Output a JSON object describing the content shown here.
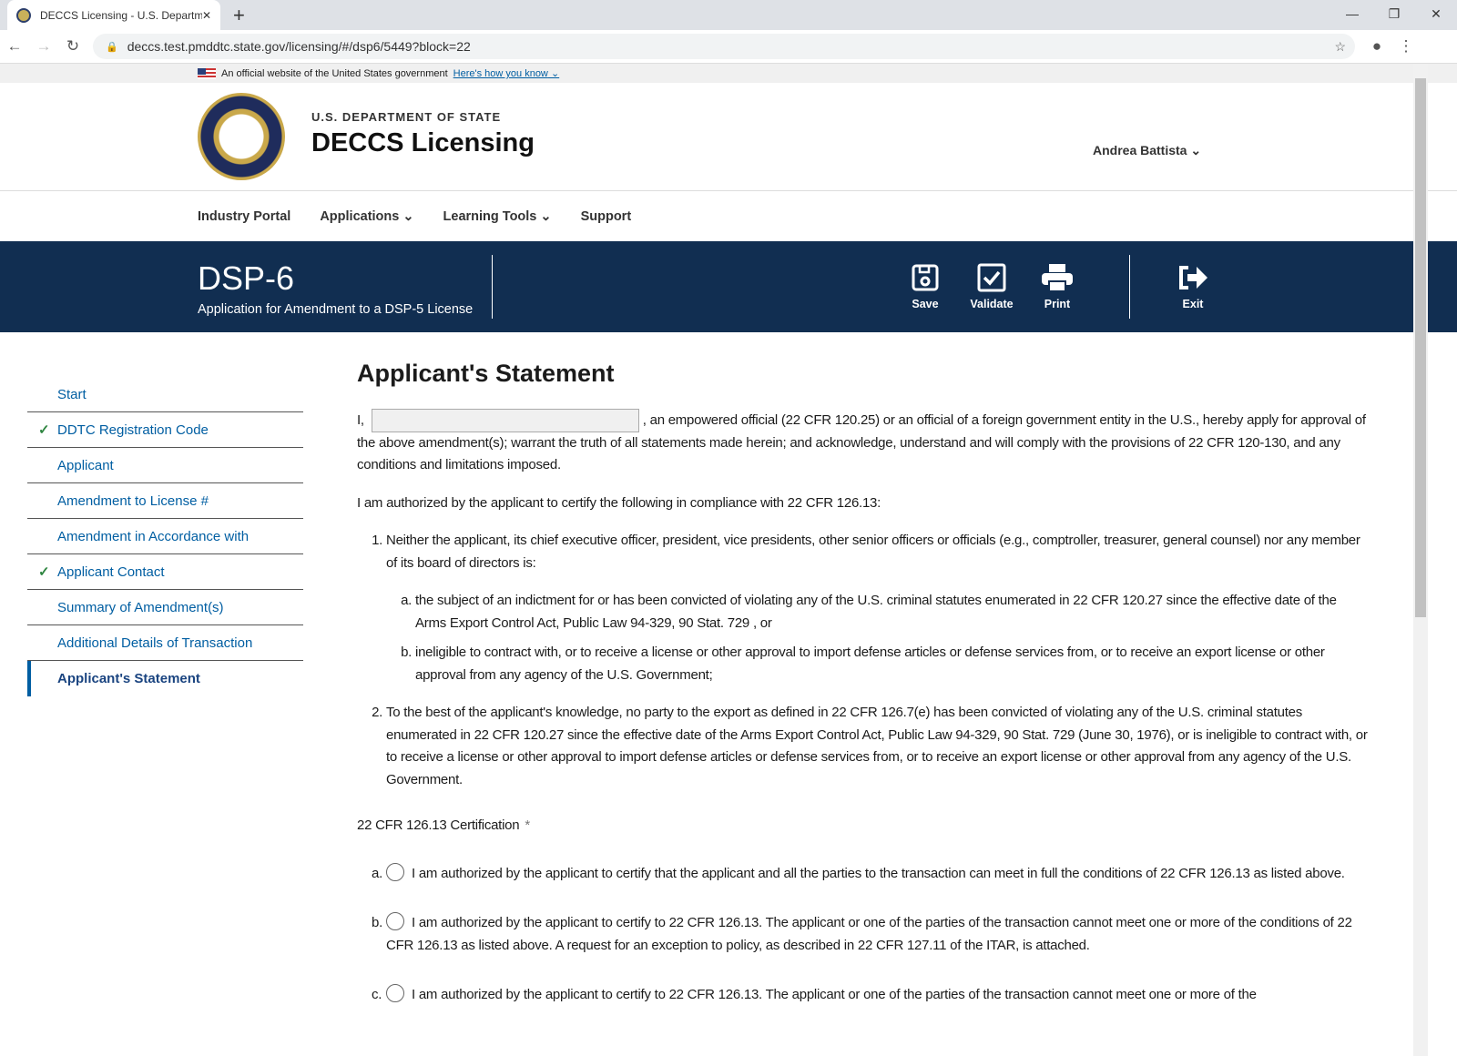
{
  "browser": {
    "tab_title": "DECCS Licensing - U.S. Departme",
    "url": "deccs.test.pmddtc.state.gov/licensing/#/dsp6/5449?block=22"
  },
  "banner": {
    "text": "An official website of the United States government",
    "link": "Here's how you know"
  },
  "header": {
    "dept": "U.S. DEPARTMENT OF STATE",
    "brand": "DECCS Licensing",
    "user": "Andrea Battista"
  },
  "nav": [
    "Industry Portal",
    "Applications",
    "Learning Tools",
    "Support"
  ],
  "band": {
    "title": "DSP-6",
    "subtitle": "Application for Amendment to a DSP-5 License",
    "tools": {
      "save": "Save",
      "validate": "Validate",
      "print": "Print",
      "exit": "Exit"
    }
  },
  "sidebar": [
    {
      "label": "Start",
      "done": false
    },
    {
      "label": "DDTC Registration Code",
      "done": true
    },
    {
      "label": "Applicant",
      "done": false
    },
    {
      "label": "Amendment to License #",
      "done": false
    },
    {
      "label": "Amendment in Accordance with",
      "done": false
    },
    {
      "label": "Applicant Contact",
      "done": true
    },
    {
      "label": "Summary of Amendment(s)",
      "done": false
    },
    {
      "label": "Additional Details of Transaction",
      "done": false
    },
    {
      "label": "Applicant's Statement",
      "done": false,
      "active": true
    }
  ],
  "main": {
    "title": "Applicant's Statement",
    "intro_pre": "I,",
    "name_value": "",
    "intro_post": ", an empowered official (22 CFR 120.25) or an official of a foreign government entity in the U.S., hereby apply for approval of the above amendment(s); warrant the truth of all statements made herein; and acknowledge, understand and will comply with the provisions of 22 CFR 120-130, and any conditions and limitations imposed.",
    "authorized": "I am authorized by the applicant to certify the following in compliance with 22 CFR 126.13:",
    "item1": "Neither the applicant, its chief executive officer, president, vice presidents, other senior officers or officials (e.g., comptroller, treasurer, general counsel) nor any member of its board of directors is:",
    "item1a": "the subject of an indictment for or has been convicted of violating any of the U.S. criminal statutes enumerated in 22 CFR 120.27 since the effective date of the Arms Export Control Act, Public Law 94-329, 90 Stat. 729 , or",
    "item1b": "ineligible to contract with, or to receive a license or other approval to import defense articles or defense services from, or to receive an export license or other approval from any agency of the U.S. Government;",
    "item2": "To the best of the applicant's knowledge, no party to the export as defined in 22 CFR 126.7(e) has been convicted of violating any of the U.S. criminal statutes enumerated in 22 CFR 120.27 since the effective date of the Arms Export Control Act, Public Law 94-329, 90 Stat. 729 (June 30, 1976), or is ineligible to contract with, or to receive a license or other approval to import defense articles or defense services from, or to receive an export license or other approval from any agency of the U.S. Government.",
    "cert_label": "22 CFR 126.13 Certification",
    "required": "*",
    "options": [
      {
        "letter": "a.",
        "text": "I am authorized by the applicant to certify that the applicant and all the parties to the transaction can meet in full the conditions of 22 CFR 126.13 as listed above."
      },
      {
        "letter": "b.",
        "text": "I am authorized by the applicant to certify to 22 CFR 126.13. The applicant or one of the parties of the transaction cannot meet one or more of the conditions of 22 CFR 126.13 as listed above. A request for an exception to policy, as described in 22 CFR 127.11 of the ITAR, is attached."
      },
      {
        "letter": "c.",
        "text": "I am authorized by the applicant to certify to 22 CFR 126.13. The applicant or one of the parties of the transaction cannot meet one or more of the"
      }
    ]
  },
  "colors": {
    "band": "#112e51",
    "link": "#005ea2",
    "check": "#2e8540"
  }
}
